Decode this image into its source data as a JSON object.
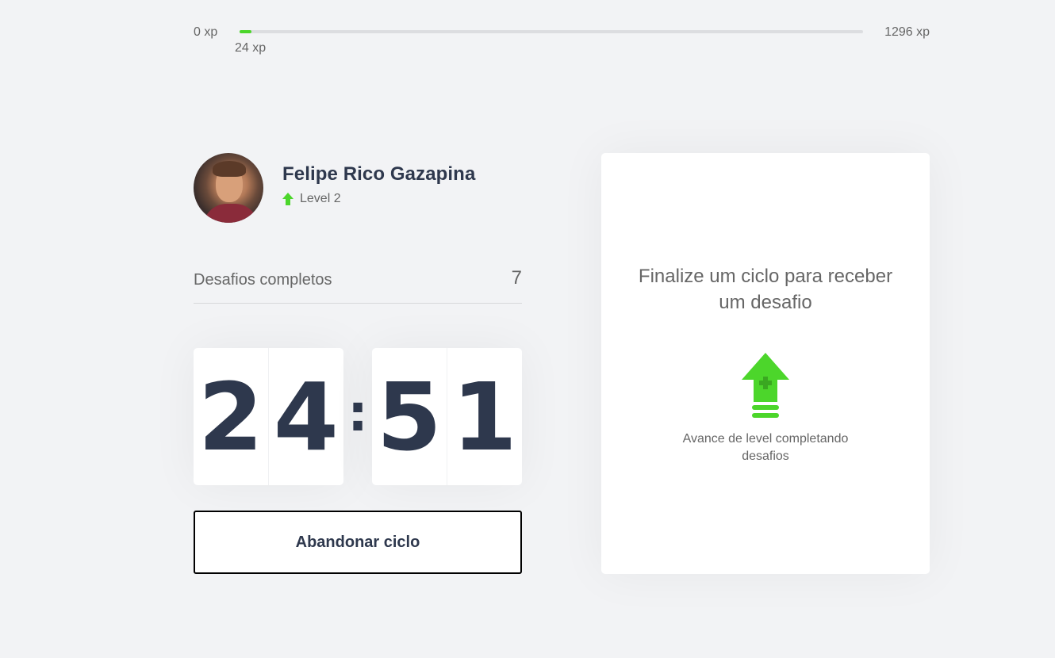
{
  "xp": {
    "min_label": "0 xp",
    "max_label": "1296 xp",
    "current_label": "24 xp",
    "progress_fraction": 0.0185,
    "accent_color": "#4cd62b"
  },
  "profile": {
    "name": "Felipe Rico Gazapina",
    "level_label": "Level 2",
    "level_icon": "level-up-arrow-icon"
  },
  "completed": {
    "label": "Desafios completos",
    "count": "7"
  },
  "countdown": {
    "minute_left": "2",
    "minute_right": "4",
    "separator": ":",
    "second_left": "5",
    "second_right": "1"
  },
  "actions": {
    "abandon_label": "Abandonar ciclo"
  },
  "challenge": {
    "title": "Finalize um ciclo para receber um desafio",
    "icon": "level-up-icon",
    "hint": "Avance de level completando desafios"
  }
}
